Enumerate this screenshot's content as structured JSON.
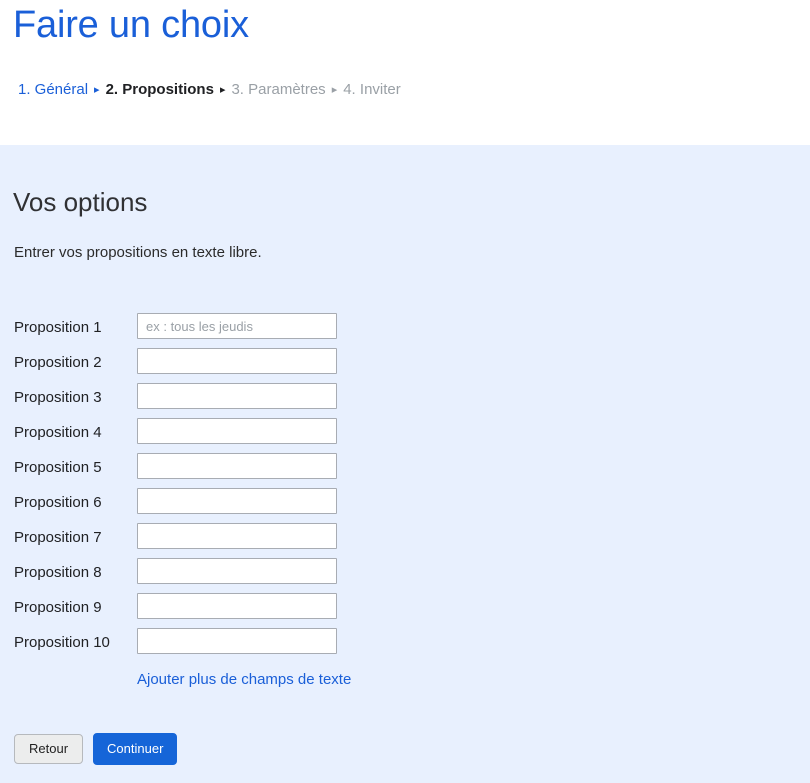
{
  "header": {
    "title": "Faire un choix",
    "breadcrumb": {
      "separator": "▸",
      "steps": [
        {
          "label": "1. Général",
          "state": "done"
        },
        {
          "label": "2. Propositions",
          "state": "current"
        },
        {
          "label": "3. Paramètres",
          "state": "todo"
        },
        {
          "label": "4. Inviter",
          "state": "todo"
        }
      ]
    }
  },
  "main": {
    "section_title": "Vos options",
    "section_description": "Entrer vos propositions en texte libre.",
    "fields": [
      {
        "label": "Proposition 1",
        "value": "",
        "placeholder": "ex : tous les jeudis"
      },
      {
        "label": "Proposition 2",
        "value": "",
        "placeholder": ""
      },
      {
        "label": "Proposition 3",
        "value": "",
        "placeholder": ""
      },
      {
        "label": "Proposition 4",
        "value": "",
        "placeholder": ""
      },
      {
        "label": "Proposition 5",
        "value": "",
        "placeholder": ""
      },
      {
        "label": "Proposition 6",
        "value": "",
        "placeholder": ""
      },
      {
        "label": "Proposition 7",
        "value": "",
        "placeholder": ""
      },
      {
        "label": "Proposition 8",
        "value": "",
        "placeholder": ""
      },
      {
        "label": "Proposition 9",
        "value": "",
        "placeholder": ""
      },
      {
        "label": "Proposition 10",
        "value": "",
        "placeholder": ""
      }
    ],
    "add_fields_link": "Ajouter plus de champs de texte"
  },
  "actions": {
    "back_label": "Retour",
    "continue_label": "Continuer"
  },
  "colors": {
    "title_blue": "#1a5fd8",
    "link_blue": "#1a5fd8",
    "primary_button": "#1565d8",
    "body_background": "#e8f0fe",
    "header_background": "#ffffff",
    "inactive_step": "#9aa0a6"
  }
}
